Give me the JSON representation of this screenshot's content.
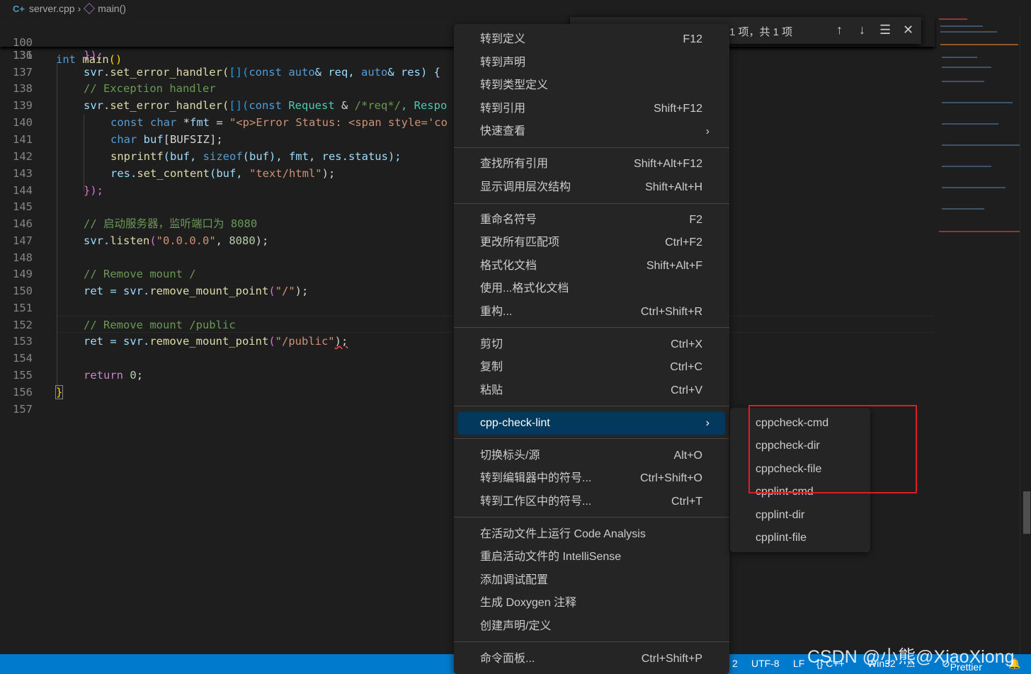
{
  "breadcrumb": {
    "file": "server.cpp",
    "symbol": "main()"
  },
  "editor": {
    "lines": [
      {
        "num": "100"
      },
      {
        "num": "131"
      },
      {
        "num": "136"
      },
      {
        "num": "137"
      },
      {
        "num": "138"
      },
      {
        "num": "139"
      },
      {
        "num": "140"
      },
      {
        "num": "141"
      },
      {
        "num": "142"
      },
      {
        "num": "143"
      },
      {
        "num": "144"
      },
      {
        "num": "145"
      },
      {
        "num": "146"
      },
      {
        "num": "147"
      },
      {
        "num": "148"
      },
      {
        "num": "149"
      },
      {
        "num": "150"
      },
      {
        "num": "151"
      },
      {
        "num": "152"
      },
      {
        "num": "153"
      },
      {
        "num": "154"
      },
      {
        "num": "155"
      },
      {
        "num": "156"
      },
      {
        "num": "157"
      }
    ],
    "code": {
      "l100_kw": "int",
      "l100_fn": "main",
      "l100_p": "()",
      "l131_a": "svr",
      "l131_b": ".set_error_handler(",
      "l131_c": "[](",
      "l131_d": "const",
      "l131_e": "auto",
      "l131_f": "& req, ",
      "l131_g": "auto",
      "l131_h": "& res) {",
      "l136": "});",
      "l138": "// Exception handler",
      "l139_a": "svr",
      "l139_b": ".set_error_handler(",
      "l139_c": "[](",
      "l139_d": "const",
      "l139_e": "Request",
      "l139_f": " & ",
      "l139_g": "/*req*/",
      "l139_h": ", Respo",
      "l140_a": "const",
      "l140_b": "char",
      "l140_c": " *",
      "l140_d": "fmt",
      "l140_e": " = ",
      "l140_f": "\"<p>Error Status: <span style='co",
      "l141_a": "char",
      "l141_b": "buf",
      "l141_c": "[BUFSIZ];",
      "l142_a": "snprintf",
      "l142_b": "(buf, ",
      "l142_c": "sizeof",
      "l142_d": "(buf), fmt, res.status);",
      "l143_a": "res.",
      "l143_b": "set_content",
      "l143_c": "(buf, ",
      "l143_d": "\"text/html\"",
      "l143_e": ");",
      "l144": "});",
      "l146": "// 启动服务器，监听端口为 8080",
      "l147_a": "svr.",
      "l147_b": "listen",
      "l147_c": "(",
      "l147_d": "\"0.0.0.0\"",
      "l147_e": ", ",
      "l147_f": "8080",
      "l147_g": ");",
      "l149": "// Remove mount /",
      "l150_a": "ret",
      "l150_b": " = svr.",
      "l150_c": "remove_mount_point",
      "l150_d": "(",
      "l150_e": "\"/\"",
      "l150_f": ");",
      "l152": "// Remove mount /public",
      "l153_a": "ret",
      "l153_b": " = svr.",
      "l153_c": "remove_mount_point",
      "l153_d": "(",
      "l153_e": "\"/public\"",
      "l153_f": ");",
      "l155_a": "return",
      "l155_b": "0",
      "l155_c": ";",
      "l156": "}"
    }
  },
  "find": {
    "count": "1 项，共 1 项"
  },
  "context_menu": {
    "items": [
      {
        "label": "转到定义",
        "shortcut": "F12"
      },
      {
        "label": "转到声明",
        "shortcut": ""
      },
      {
        "label": "转到类型定义",
        "shortcut": ""
      },
      {
        "label": "转到引用",
        "shortcut": "Shift+F12"
      },
      {
        "label": "快速查看",
        "shortcut": ""
      },
      {
        "label": "查找所有引用",
        "shortcut": "Shift+Alt+F12"
      },
      {
        "label": "显示调用层次结构",
        "shortcut": "Shift+Alt+H"
      },
      {
        "label": "重命名符号",
        "shortcut": "F2"
      },
      {
        "label": "更改所有匹配项",
        "shortcut": "Ctrl+F2"
      },
      {
        "label": "格式化文档",
        "shortcut": "Shift+Alt+F"
      },
      {
        "label": "使用...格式化文档",
        "shortcut": ""
      },
      {
        "label": "重构...",
        "shortcut": "Ctrl+Shift+R"
      },
      {
        "label": "剪切",
        "shortcut": "Ctrl+X"
      },
      {
        "label": "复制",
        "shortcut": "Ctrl+C"
      },
      {
        "label": "粘贴",
        "shortcut": "Ctrl+V"
      },
      {
        "label": "cpp-check-lint",
        "shortcut": ""
      },
      {
        "label": "切换标头/源",
        "shortcut": "Alt+O"
      },
      {
        "label": "转到编辑器中的符号...",
        "shortcut": "Ctrl+Shift+O"
      },
      {
        "label": "转到工作区中的符号...",
        "shortcut": "Ctrl+T"
      },
      {
        "label": "在活动文件上运行 Code Analysis",
        "shortcut": ""
      },
      {
        "label": "重启活动文件的 IntelliSense",
        "shortcut": ""
      },
      {
        "label": "添加调试配置",
        "shortcut": ""
      },
      {
        "label": "生成 Doxygen 注释",
        "shortcut": ""
      },
      {
        "label": "创建声明/定义",
        "shortcut": ""
      },
      {
        "label": "命令面板...",
        "shortcut": "Ctrl+Shift+P"
      }
    ]
  },
  "submenu": {
    "items": [
      "cppcheck-cmd",
      "cppcheck-dir",
      "cppcheck-file",
      "cpplint-cmd",
      "cpplint-dir",
      "cpplint-file"
    ]
  },
  "statusbar": {
    "spaces": "2",
    "encoding": "UTF-8",
    "eol": "LF",
    "language": "{} C++",
    "platform": "Win32",
    "prettier": "Prettier"
  },
  "watermark": "CSDN @小熊@XiaoXiong",
  "colors": {
    "accent": "#007acc",
    "menu_bg": "#252526",
    "highlight": "#04395e",
    "annotation": "#e01b24"
  }
}
